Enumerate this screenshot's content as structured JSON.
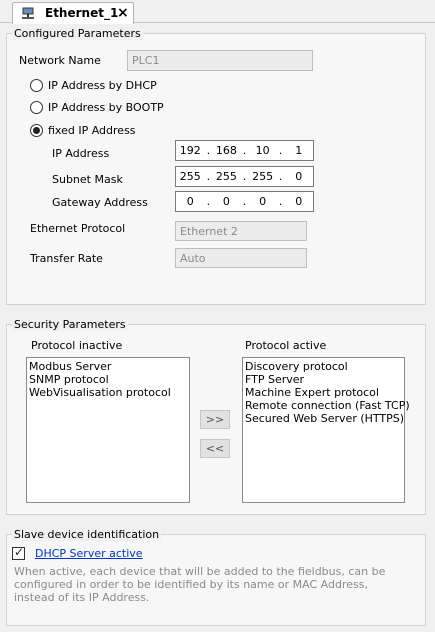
{
  "tab": {
    "title": "Ethernet_1",
    "icon": "network-device-icon",
    "close_icon": "close-icon"
  },
  "configured": {
    "title": "Configured Parameters",
    "network_name_label": "Network Name",
    "network_name_value": "PLC1",
    "radio_dhcp": "IP Address by DHCP",
    "radio_bootp": "IP Address by BOOTP",
    "radio_fixed": "fixed IP Address",
    "selected": "fixed",
    "ip_label": "IP Address",
    "ip": [
      "192",
      "168",
      "10",
      "1"
    ],
    "subnet_label": "Subnet Mask",
    "subnet": [
      "255",
      "255",
      "255",
      "0"
    ],
    "gateway_label": "Gateway Address",
    "gateway": [
      "0",
      "0",
      "0",
      "0"
    ],
    "protocol_label": "Ethernet Protocol",
    "protocol_value": "Ethernet 2",
    "rate_label": "Transfer Rate",
    "rate_value": "Auto"
  },
  "security": {
    "title": "Security Parameters",
    "inactive_label": "Protocol inactive",
    "inactive": [
      "Modbus Server",
      "SNMP protocol",
      "WebVisualisation protocol"
    ],
    "active_label": "Protocol active",
    "active": [
      "Discovery protocol",
      "FTP Server",
      "Machine Expert protocol",
      "Remote connection (Fast TCP)",
      "Secured Web Server (HTTPS)"
    ],
    "add_button": ">>",
    "remove_button": "<<"
  },
  "slave": {
    "title": "Slave device identification",
    "dhcp_server_label": "DHCP Server active",
    "dhcp_server_checked": true,
    "description": "When active, each device that will be added to the fieldbus, can be configured in order to be identified by its name or MAC Address, instead of its IP Address."
  }
}
